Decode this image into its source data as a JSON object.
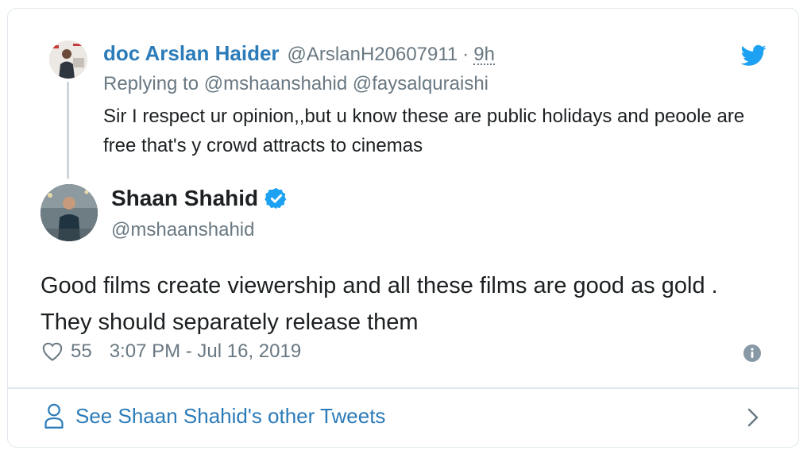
{
  "parent_tweet": {
    "author_name": "doc Arslan Haider",
    "handle": "@ArslanH20607911",
    "separator": "·",
    "time": "9h",
    "replying_prefix": "Replying to",
    "replying_to_1": "@mshaanshahid",
    "replying_to_2": "@faysalquraishi",
    "text": "Sir I respect ur opinion,,but u know these are public holidays and peoole are free that's y crowd attracts to cinemas"
  },
  "main_tweet": {
    "author_name": "Shaan Shahid",
    "handle": "@mshaanshahid",
    "text": "Good films create viewership and all these films are good as gold . They should separately release them",
    "likes": "55",
    "timestamp": "3:07 PM - Jul 16, 2019"
  },
  "footer": {
    "link_text": "See Shaan Shahid's other Tweets"
  },
  "icons": {
    "brand": "twitter-bird-icon",
    "verified": "verified-badge-icon",
    "like": "heart-icon",
    "info": "info-icon",
    "footer_person": "person-icon",
    "footer_arrow": "chevron-right-icon"
  },
  "colors": {
    "link_blue": "#2b7bb9",
    "twitter_blue": "#1da1f2",
    "muted_text": "#697882",
    "border": "#e1e8ed"
  }
}
